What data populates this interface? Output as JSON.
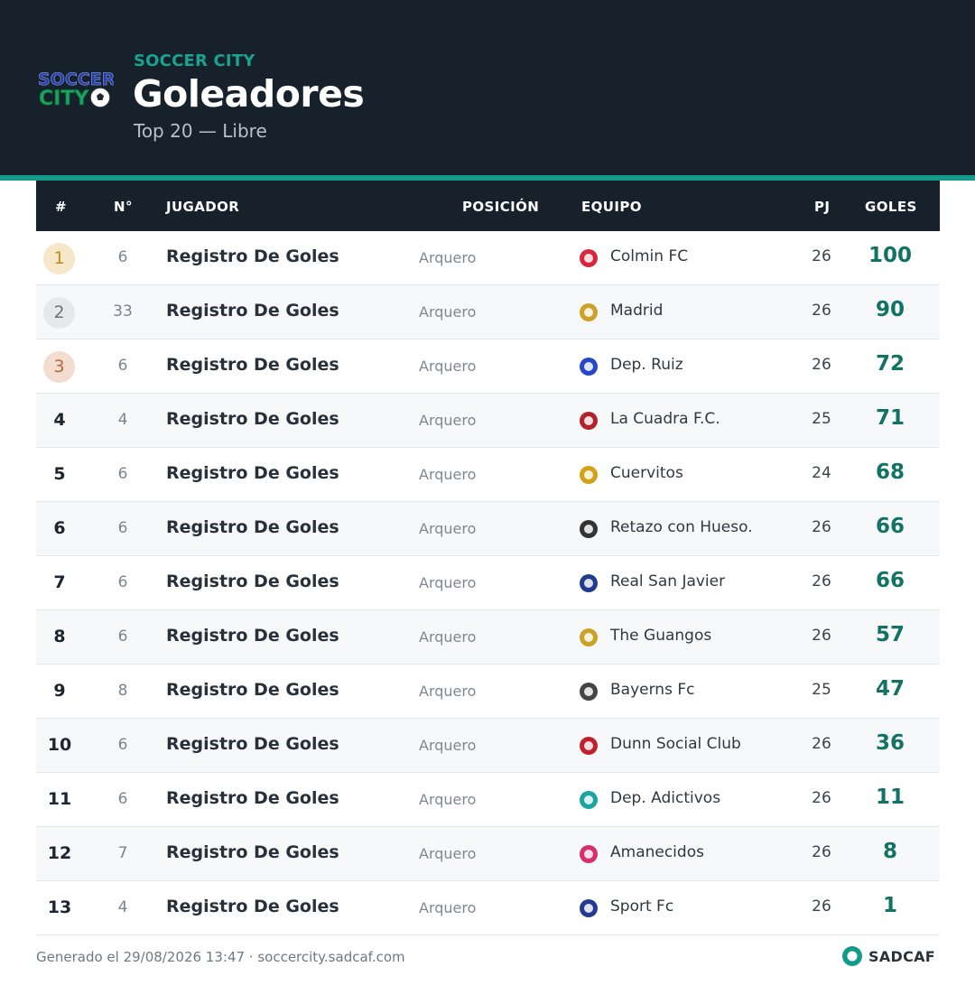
{
  "header": {
    "logo_text_top": "SOCCER",
    "logo_text_bottom": "CITY",
    "brand": "SOCCER CITY",
    "title": "Goleadores",
    "subtitle": "Top 20 — Libre"
  },
  "table": {
    "columns": {
      "rank": "#",
      "number": "N°",
      "player": "JUGADOR",
      "position": "POSICIÓN",
      "team": "EQUIPO",
      "pj": "PJ",
      "goals": "GOLES"
    },
    "rows": [
      {
        "rank": "1",
        "number": "6",
        "player": "Registro De Goles",
        "position": "Arquero",
        "team": "Colmin FC",
        "pj": "26",
        "goals": "100",
        "badge_color": "#d7263d",
        "badge_icon": "colmin-badge-icon"
      },
      {
        "rank": "2",
        "number": "33",
        "player": "Registro De Goles",
        "position": "Arquero",
        "team": "Madrid",
        "pj": "26",
        "goals": "90",
        "badge_color": "#c9a227",
        "badge_icon": "madrid-badge-icon"
      },
      {
        "rank": "3",
        "number": "6",
        "player": "Registro De Goles",
        "position": "Arquero",
        "team": "Dep. Ruiz",
        "pj": "26",
        "goals": "72",
        "badge_color": "#2747c8",
        "badge_icon": "dep-ruiz-badge-icon"
      },
      {
        "rank": "4",
        "number": "4",
        "player": "Registro De Goles",
        "position": "Arquero",
        "team": "La Cuadra F.C.",
        "pj": "25",
        "goals": "71",
        "badge_color": "#b3212d",
        "badge_icon": "la-cuadra-badge-icon"
      },
      {
        "rank": "5",
        "number": "6",
        "player": "Registro De Goles",
        "position": "Arquero",
        "team": "Cuervitos",
        "pj": "24",
        "goals": "68",
        "badge_color": "#d4a017",
        "badge_icon": "cuervitos-badge-icon"
      },
      {
        "rank": "6",
        "number": "6",
        "player": "Registro De Goles",
        "position": "Arquero",
        "team": "Retazo con Hueso.",
        "pj": "26",
        "goals": "66",
        "badge_color": "#333333",
        "badge_icon": "retazo-badge-icon"
      },
      {
        "rank": "7",
        "number": "6",
        "player": "Registro De Goles",
        "position": "Arquero",
        "team": "Real San Javier",
        "pj": "26",
        "goals": "66",
        "badge_color": "#1f3b8a",
        "badge_icon": "real-san-javier-badge-icon"
      },
      {
        "rank": "8",
        "number": "6",
        "player": "Registro De Goles",
        "position": "Arquero",
        "team": "The Guangos",
        "pj": "26",
        "goals": "57",
        "badge_color": "#c9a227",
        "badge_icon": "the-guangos-badge-icon"
      },
      {
        "rank": "9",
        "number": "8",
        "player": "Registro De Goles",
        "position": "Arquero",
        "team": "Bayerns Fc",
        "pj": "25",
        "goals": "47",
        "badge_color": "#444444",
        "badge_icon": "bayerns-badge-icon"
      },
      {
        "rank": "10",
        "number": "6",
        "player": "Registro De Goles",
        "position": "Arquero",
        "team": "Dunn Social Club",
        "pj": "26",
        "goals": "36",
        "badge_color": "#c0202c",
        "badge_icon": "dunn-badge-icon"
      },
      {
        "rank": "11",
        "number": "6",
        "player": "Registro De Goles",
        "position": "Arquero",
        "team": "Dep. Adictivos",
        "pj": "26",
        "goals": "11",
        "badge_color": "#1aa3a0",
        "badge_icon": "dep-adictivos-badge-icon"
      },
      {
        "rank": "12",
        "number": "7",
        "player": "Registro De Goles",
        "position": "Arquero",
        "team": "Amanecidos",
        "pj": "26",
        "goals": "8",
        "badge_color": "#d62f6a",
        "badge_icon": "amanecidos-badge-icon"
      },
      {
        "rank": "13",
        "number": "4",
        "player": "Registro De Goles",
        "position": "Arquero",
        "team": "Sport Fc",
        "pj": "26",
        "goals": "1",
        "badge_color": "#243a8f",
        "badge_icon": "sport-fc-badge-icon"
      }
    ]
  },
  "footer": {
    "generated": "Generado el 29/08/2026 13:47 · soccercity.sadcaf.com",
    "sadcaf_label": "SADCAF"
  },
  "colors": {
    "header_bg": "#17212b",
    "accent": "#139b8a",
    "goals": "#127264"
  }
}
